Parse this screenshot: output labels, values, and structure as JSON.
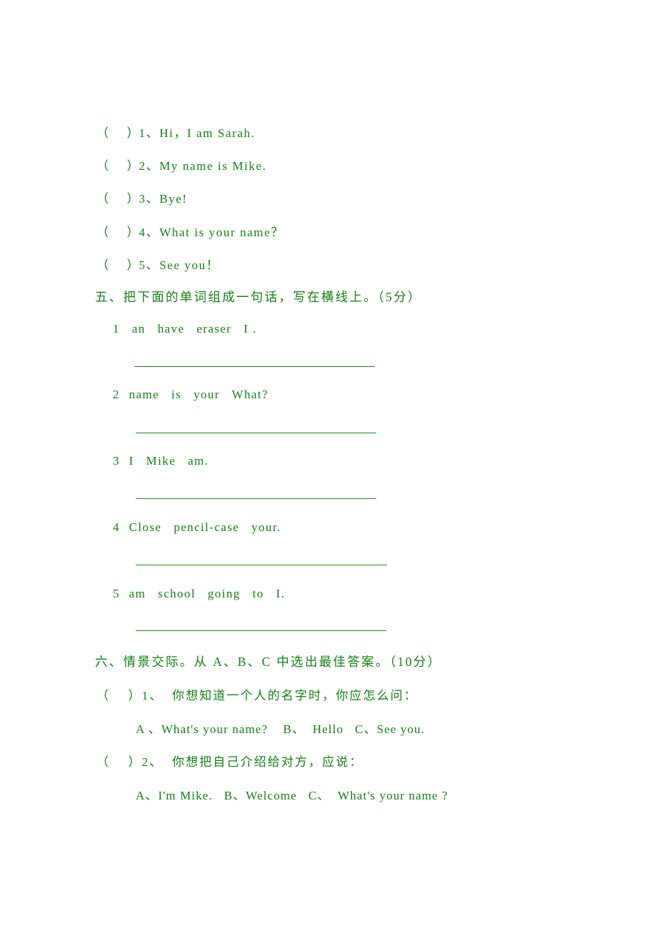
{
  "document": {
    "text_color": "#138013",
    "rule_color": "#1a8a1a",
    "background": "#ffffff"
  },
  "judge_items": [
    {
      "brackets": "（      ）",
      "number": "1、",
      "text": "Hi，I am Sarah."
    },
    {
      "brackets": "（      ）",
      "number": "2、",
      "text": "My name is Mike."
    },
    {
      "brackets": "（      ）",
      "number": "3、",
      "text": "Bye!"
    },
    {
      "brackets": "（      ）",
      "number": "4、",
      "text": "What is your name？"
    },
    {
      "brackets": "（      ）",
      "number": "5、",
      "text": "See you！"
    }
  ],
  "section_five": {
    "heading": "五、把下面的单词组成一句话，写在横线上。（5分）",
    "items": [
      {
        "number": "1",
        "words": "an   have   eraser   I ."
      },
      {
        "number": "2",
        "words": "name   is   your   What?"
      },
      {
        "number": "3",
        "words": "I   Mike   am."
      },
      {
        "number": "4",
        "words": "Close   pencil-case   your."
      },
      {
        "number": "5",
        "words": "am   school   going   to   I."
      }
    ]
  },
  "section_six": {
    "heading": "六、情景交际。从 A、B、C 中选出最佳答案。（10分）",
    "questions": [
      {
        "brackets": "（    ）",
        "number": "1、",
        "prompt": "  你想知道一个人的名字时，你应怎么问：",
        "options": "A 、What's your name?    B、  Hello   C、See you."
      },
      {
        "brackets": "（    ）",
        "number": "2、",
        "prompt": "  你想把自己介绍给对方，应说：",
        "options": "A、I'm Mike.   B、Welcome   C、  What's your name ?"
      }
    ]
  }
}
